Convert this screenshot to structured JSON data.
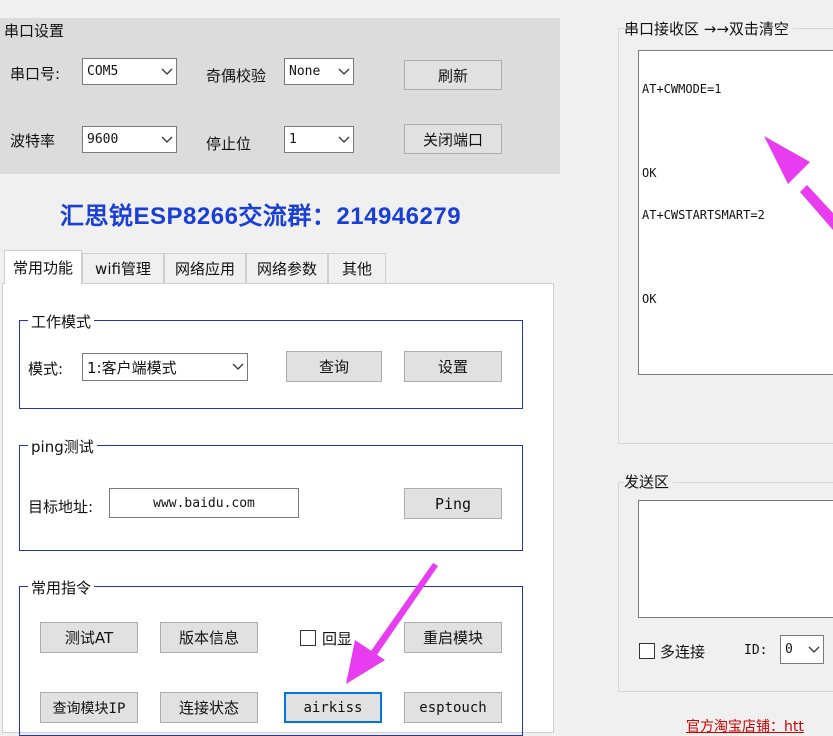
{
  "serial": {
    "group_title": "串口设置",
    "port_label": "串口号:",
    "port_value": "COM5",
    "parity_label": "奇偶校验",
    "parity_value": "None",
    "refresh_label": "刷新",
    "baud_label": "波特率",
    "baud_value": "9600",
    "stopbit_label": "停止位",
    "stopbit_value": "1",
    "close_port_label": "关闭端口"
  },
  "banner": "汇思锐ESP8266交流群：214946279",
  "tabs": [
    {
      "label": "常用功能",
      "active": true
    },
    {
      "label": "wifi管理"
    },
    {
      "label": "网络应用"
    },
    {
      "label": "网络参数"
    },
    {
      "label": "其他"
    }
  ],
  "work_mode": {
    "group_title": "工作模式",
    "mode_label": "模式:",
    "mode_value": "1:客户端模式",
    "query_label": "查询",
    "set_label": "设置"
  },
  "ping": {
    "group_title": "ping测试",
    "target_label": "目标地址:",
    "target_value": "www.baidu.com",
    "ping_label": "Ping"
  },
  "common": {
    "group_title": "常用指令",
    "test_at": "测试AT",
    "version": "版本信息",
    "echo_label": "回显",
    "restart": "重启模块",
    "query_ip": "查询模块IP",
    "conn_status": "连接状态",
    "airkiss": "airkiss",
    "esptouch": "esptouch"
  },
  "receive": {
    "group_title": "串口接收区 →→双击清空",
    "lines": [
      "AT+CWMODE=1",
      "",
      "OK",
      "AT+CWSTARTSMART=2",
      "",
      "OK"
    ]
  },
  "send": {
    "group_title": "发送区",
    "multi_conn_label": "多连接",
    "id_label": "ID:",
    "id_value": "0"
  },
  "footer_link": "官方淘宝店铺：htt",
  "colors": {
    "banner": "#1a3fd6",
    "group_blue": "#1f33c8",
    "arrow": "#e83cf0",
    "footer": "#d00000"
  }
}
